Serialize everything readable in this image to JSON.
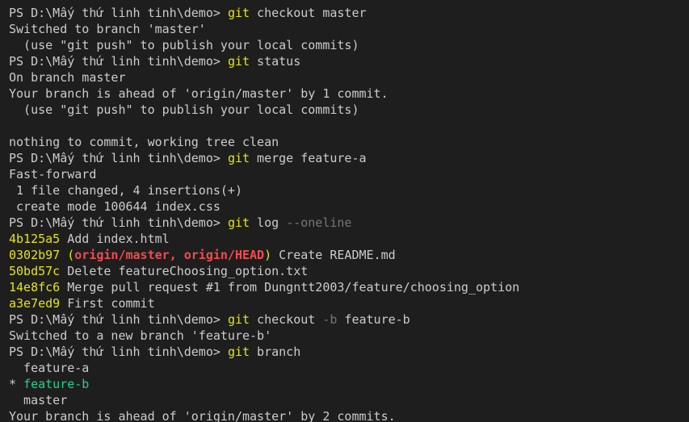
{
  "terminal": {
    "prompt": "PS D:\\Mấy thứ linh tinh\\demo> ",
    "cmd1": {
      "git": "git",
      "rest": " checkout master"
    },
    "out1": [
      "Switched to branch 'master'",
      "  (use \"git push\" to publish your local commits)"
    ],
    "cmd2": {
      "git": "git",
      "rest": " status"
    },
    "out2": [
      "On branch master",
      "Your branch is ahead of 'origin/master' by 1 commit.",
      "  (use \"git push\" to publish your local commits)",
      "",
      "nothing to commit, working tree clean"
    ],
    "cmd3": {
      "git": "git",
      "rest": " merge feature-a"
    },
    "out3": [
      "Fast-forward",
      " 1 file changed, 4 insertions(+)",
      " create mode 100644 index.css"
    ],
    "cmd4": {
      "git": "git",
      "rest": " log ",
      "flag": "--oneline"
    },
    "log": {
      "c1": {
        "hash": "4b125a5",
        "msg": " Add index.html"
      },
      "c2": {
        "hash": "0302b97",
        "open": " (",
        "refs": "origin/master, origin/HEAD",
        "close": ")",
        "msg": " Create README.md"
      },
      "c3": {
        "hash": "50bd57c",
        "msg": " Delete featureChoosing_option.txt"
      },
      "c4": {
        "hash": "14e8fc6",
        "msg": " Merge pull request #1 from Dungntt2003/feature/choosing_option"
      },
      "c5": {
        "hash": "a3e7ed9",
        "msg": " First commit"
      }
    },
    "cmd5": {
      "git": "git",
      "rest1": " checkout ",
      "flag": "-b",
      "rest2": " feature-b"
    },
    "out5": [
      "Switched to a new branch 'feature-b'"
    ],
    "cmd6": {
      "git": "git",
      "rest": " branch"
    },
    "branches": {
      "b1": "  feature-a",
      "b2_marker": "* ",
      "b2": "feature-b",
      "b3": "  master"
    },
    "out7": [
      "Your branch is ahead of 'origin/master' by 2 commits."
    ],
    "colors": {
      "background": "#1e1e1e",
      "text": "#cccccc",
      "command": "#e5e510",
      "flag": "#767676",
      "ref": "#f14c4c",
      "current_branch": "#23d18b"
    }
  }
}
